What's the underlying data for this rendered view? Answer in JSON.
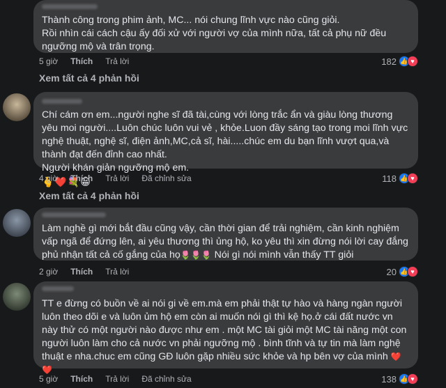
{
  "comments": [
    {
      "text": "Thành công trong phim ảnh, MC... nói chung lĩnh vực nào cũng giỏi.\nRồi nhìn cái cách cậu ấy đối xử với người vợ của mình nữa, tất cả phụ nữ đều ngưỡng mộ và trân trọng.",
      "time": "5 giờ",
      "like": "Thích",
      "reply": "Trả lời",
      "reaction_count": "182",
      "view_replies": "Xem tất cả 4 phản hồi"
    },
    {
      "text": "Chí cám ơn em...người nghe sĩ đã tài,cùng với lòng trắc ẩn và giàu lòng thương yêu moi người....Luôn chúc luôn vui vẻ , khỏe.Luon đầy sáng tạo trong moi lĩnh vực nghệ thuật, nghệ sĩ, điện ảnh,MC,cả sĩ, hài.....chúc em du bạn lĩnh vượt qua,và thành đạt đến đỉnh cao nhất.\nNgười khán giản ngưỡng mộ em.",
      "emoji": "🫰❤️💐😀",
      "time": "4 giờ",
      "like": "Thích",
      "reply": "Trả lời",
      "edited": "Đã chỉnh sửa",
      "reaction_count": "118",
      "view_replies": "Xem tất cả 4 phản hồi"
    },
    {
      "text_main": "Làm nghề gì mới bắt đầu cũng vậy, cần thời gian để trải nghiệm, cần kinh nghiệm vấp ngã để đứng lên, ai yêu thương thì ủng hộ, ko yêu thì xin đừng nói lời cay đắng phủ nhận tất cả cố gắng của họ",
      "emoji": "🌷🌷🌷",
      "text_tail": "Nói gì nói mình vẫn thấy TT giỏi",
      "time": "2 giờ",
      "like": "Thích",
      "reply": "Trả lời",
      "reaction_count": "20"
    },
    {
      "text": "TT e đừng có buồn về ai nói gi về em.mà em phải thật tự hào và hàng ngàn người luôn theo dõi e và luôn ủm hộ em còn ai muốn nói gì thì kệ họ.ở cái đất nước vn này thử có một người nào được như em . một MC tài giỏi một MC tài năng một con người luôn làm cho cả nước vn phải ngưỡng mộ . bình tĩnh và tự tin mà làm nghệ thuật e nha.chuc em cũng GĐ luôn gặp nhiều sức khỏe và hp bên vợ của mình",
      "emoji": "❤️❤️",
      "time": "5 giờ",
      "like": "Thích",
      "reply": "Trả lời",
      "edited": "Đã chỉnh sửa",
      "reaction_count": "138"
    }
  ],
  "icons": {
    "like": "👍",
    "love": "♥"
  },
  "colors": {
    "background": "#18191a",
    "bubble": "#3a3b3c",
    "text": "#e4e6eb",
    "secondary_text": "#b0b3b8",
    "like_blue": "#1877f2",
    "love_red": "#f33e58"
  }
}
